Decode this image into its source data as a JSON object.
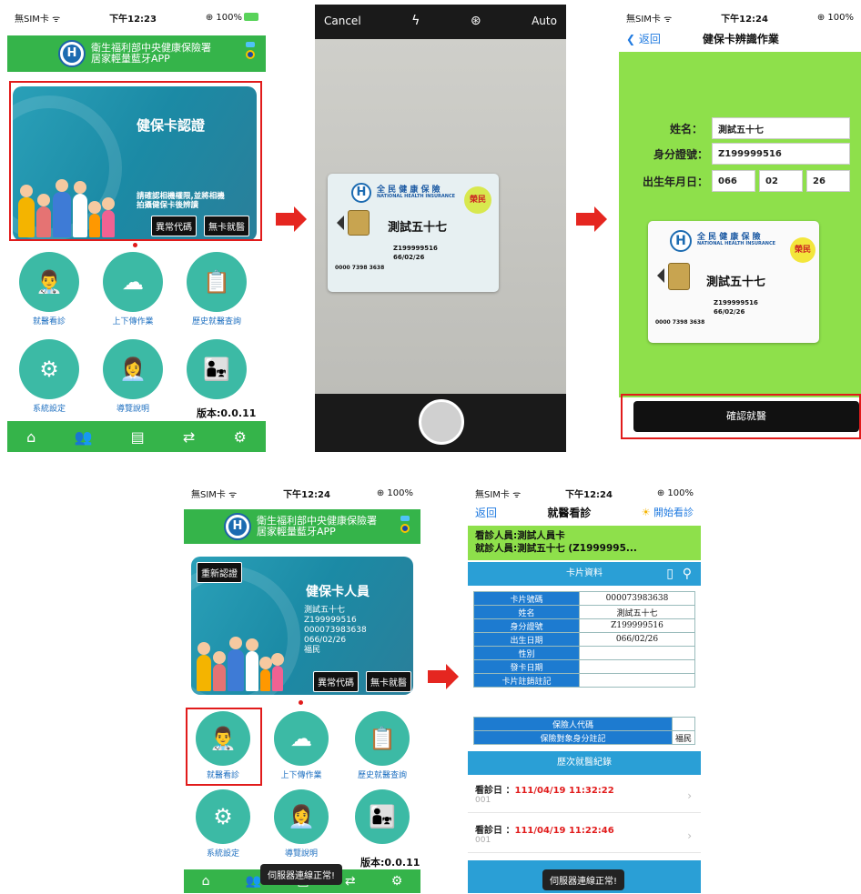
{
  "screen1": {
    "status": {
      "carrier": "無SIM卡 ᯤ",
      "time": "下午12:23",
      "battery": "⊕ 100%"
    },
    "header": {
      "line1": "衛生福利部中央健康保險署",
      "line2": "居家輕量藍牙APP"
    },
    "card": {
      "title": "健保卡認證",
      "desc_line1": "請確認相機權限,並將相機",
      "desc_line2": "拍攝健保卡後辨讀",
      "btn_abnormal": "異常代碼",
      "btn_nocard": "無卡就醫"
    },
    "icons": [
      {
        "label": "就醫看診",
        "icon": "doctor-patient-icon"
      },
      {
        "label": "上下傳作業",
        "icon": "cloud-upload-icon"
      },
      {
        "label": "歷史就醫查詢",
        "icon": "medical-record-icon"
      },
      {
        "label": "系統設定",
        "icon": "gear-icon"
      },
      {
        "label": "導覽說明",
        "icon": "guide-person-icon"
      },
      {
        "label": "",
        "icon": "doctor-family-icon"
      }
    ],
    "version": "版本:0.0.11",
    "tabs": [
      "home-icon",
      "users-icon",
      "id-card-icon",
      "sync-icon",
      "settings-icon"
    ]
  },
  "screen2": {
    "cancel": "Cancel",
    "auto": "Auto",
    "card": {
      "title": "全 民 健 康 保 險",
      "subtitle": "NATIONAL HEALTH INSURANCE",
      "name": "測試五十七",
      "id": "Z199999516",
      "dob": "66/02/26",
      "number": "0000 7398 3638",
      "seal": "榮民"
    }
  },
  "screen3": {
    "status": {
      "carrier": "無SIM卡 ᯤ",
      "time": "下午12:24",
      "battery": "⊕ 100%"
    },
    "back": "返回",
    "title": "健保卡辨識作業",
    "name_label": "姓名：",
    "name_value": "測試五十七",
    "id_label": "身分證號：",
    "id_value": "Z199999516",
    "dob_label": "出生年月日：",
    "dob_y": "066",
    "dob_m": "02",
    "dob_d": "26",
    "card": {
      "title": "全 民 健 康 保 險",
      "subtitle": "NATIONAL HEALTH INSURANCE",
      "name": "測試五十七",
      "id": "Z199999516",
      "dob": "66/02/26",
      "number": "0000 7398 3638",
      "seal": "榮民"
    },
    "confirm": "確認就醫"
  },
  "screen4": {
    "status": {
      "carrier": "無SIM卡 ᯤ",
      "time": "下午12:24",
      "battery": "⊕ 100%"
    },
    "header": {
      "line1": "衛生福利部中央健康保險署",
      "line2": "居家輕量藍牙APP"
    },
    "card": {
      "reauth": "重新認證",
      "title": "健保卡人員",
      "name": "測試五十七",
      "id": "Z199999516",
      "number": "000073983638",
      "dob": "066/02/26",
      "seal": "福民",
      "btn_abnormal": "異常代碼",
      "btn_nocard": "無卡就醫"
    },
    "icons": [
      {
        "label": "就醫看診"
      },
      {
        "label": "上下傳作業"
      },
      {
        "label": "歷史就醫查詢"
      },
      {
        "label": "系統設定"
      },
      {
        "label": "導覽說明"
      },
      {
        "label": ""
      }
    ],
    "version": "版本:0.0.11",
    "toast": "伺服器連線正常!"
  },
  "screen5": {
    "status": {
      "carrier": "無SIM卡 ᯤ",
      "time": "下午12:24",
      "battery": "⊕ 100%"
    },
    "back": "返回",
    "title": "就醫看診",
    "start": "開始看診",
    "doctor": "看診人員:測試人員卡",
    "patient": "就診人員:測試五十七 (Z1999995...",
    "card_section": "卡片資料",
    "rows": [
      {
        "k": "卡片號碼",
        "v": "000073983638"
      },
      {
        "k": "姓名",
        "v": "測試五十七"
      },
      {
        "k": "身分證號",
        "v": "Z199999516"
      },
      {
        "k": "出生日期",
        "v": "066/02/26"
      },
      {
        "k": "性別",
        "v": ""
      },
      {
        "k": "發卡日期",
        "v": ""
      },
      {
        "k": "卡片註銷註記",
        "v": ""
      }
    ],
    "insurer_label": "保險人代碼",
    "insurer_value": "",
    "identity_label": "保險對象身分註記",
    "identity_value": "福民",
    "history_title": "歷次就醫紀錄",
    "visits": [
      {
        "label": "看診日 ：",
        "date": "111/04/19 11:32:22",
        "sub": "001"
      },
      {
        "label": "看診日 ：",
        "date": "111/04/19 11:22:46",
        "sub": "001"
      }
    ],
    "toast": "伺服器連線正常!"
  }
}
